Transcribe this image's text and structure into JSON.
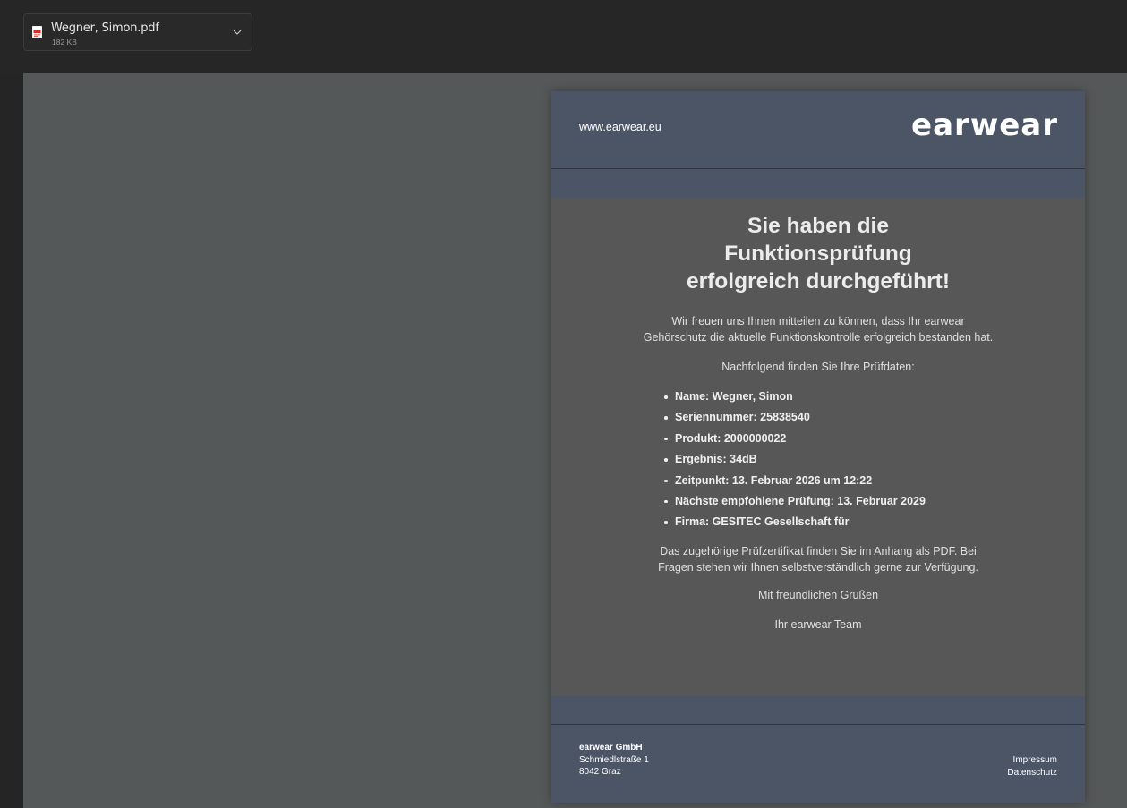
{
  "attachment": {
    "file_name": "Wegner, Simon.pdf",
    "file_size": "182 KB",
    "icon": "pdf-file-icon"
  },
  "document": {
    "header": {
      "website": "www.earwear.eu",
      "logo": "earwear"
    },
    "headline_lines": [
      "Sie haben die",
      "Funktionsprüfung",
      "erfolgreich durchgeführt!"
    ],
    "intro": "Wir freuen uns Ihnen mitteilen zu können, dass Ihr earwear Gehörschutz die aktuelle Funktionskontrolle erfolgreich bestanden hat.",
    "sub_intro": "Nachfolgend finden Sie Ihre Prüfdaten:",
    "facts": [
      "Name: Wegner, Simon",
      "Seriennummer: 25838540",
      "Produkt: 2000000022",
      "Ergebnis: 34dB",
      "Zeitpunkt: 13. Februar 2026 um 12:22",
      "Nächste empfohlene Prüfung: 13. Februar 2029",
      "Firma: GESITEC Gesellschaft für"
    ],
    "closing": "Das zugehörige Prüfzertifikat finden Sie im Anhang als PDF. Bei Fragen stehen wir Ihnen selbstverständlich gerne zur Verfügung.",
    "greeting": "Mit freundlichen Grüßen",
    "team": "Ihr earwear Team",
    "footer": {
      "company_name": "earwear GmbH",
      "street": "Schmiedlstraße 1",
      "city": "8042 Graz",
      "imprint": "Impressum",
      "privacy": "Datenschutz"
    }
  },
  "colors": {
    "app_background": "#262626",
    "viewer_background": "#555859",
    "page_background": "#575757",
    "brand_band": "#4c5566"
  }
}
